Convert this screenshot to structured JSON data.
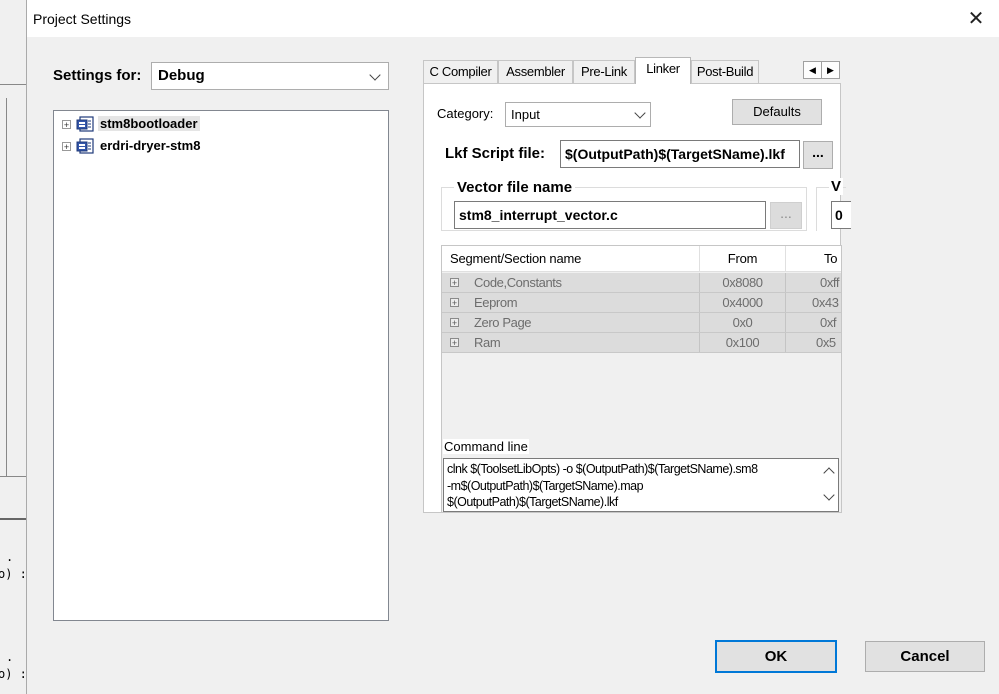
{
  "dialog": {
    "title": "Project Settings",
    "close_glyph": "✕"
  },
  "settings_for": {
    "label": "Settings for:",
    "value": "Debug"
  },
  "tree": {
    "items": [
      {
        "label": "stm8bootloader",
        "expander": "+",
        "icon": "project-icon"
      },
      {
        "label": "erdri-dryer-stm8",
        "expander": "+",
        "icon": "project-icon"
      }
    ]
  },
  "tabs": {
    "items": [
      "C Compiler",
      "Assembler",
      "Pre-Link",
      "Linker",
      "Post-Build"
    ],
    "active": "Linker",
    "scroll_left": "◀",
    "scroll_right": "▶"
  },
  "linker": {
    "category_label": "Category:",
    "category_value": "Input",
    "defaults_label": "Defaults",
    "lkf_label": "Lkf Script file:",
    "lkf_value": "$(OutputPath)$(TargetSName).lkf",
    "lkf_browse": "...",
    "vector_group_label": "Vector file name",
    "vector_value": "stm8_interrupt_vector.c",
    "vector_browse": "...",
    "vector2_label": "V",
    "vector2_value": "0"
  },
  "segments": {
    "columns": [
      "Segment/Section name",
      "From",
      "To"
    ],
    "rows": [
      {
        "name": "Code,Constants",
        "from": "0x8080",
        "to": "0xff"
      },
      {
        "name": "Eeprom",
        "from": "0x4000",
        "to": "0x43"
      },
      {
        "name": "Zero Page",
        "from": "0x0",
        "to": "0xf"
      },
      {
        "name": "Ram",
        "from": "0x100",
        "to": "0x5"
      }
    ]
  },
  "command_line": {
    "label": "Command line",
    "lines": [
      "clnk $(ToolsetLibOpts) -o $(OutputPath)$(TargetSName).sm8",
      "-m$(OutputPath)$(TargetSName).map",
      "$(OutputPath)$(TargetSName).lkf"
    ]
  },
  "buttons": {
    "ok": "OK",
    "cancel": "Cancel"
  },
  "background": {
    "fragments": [
      ".",
      "o) :",
      ".",
      "o) :"
    ]
  }
}
